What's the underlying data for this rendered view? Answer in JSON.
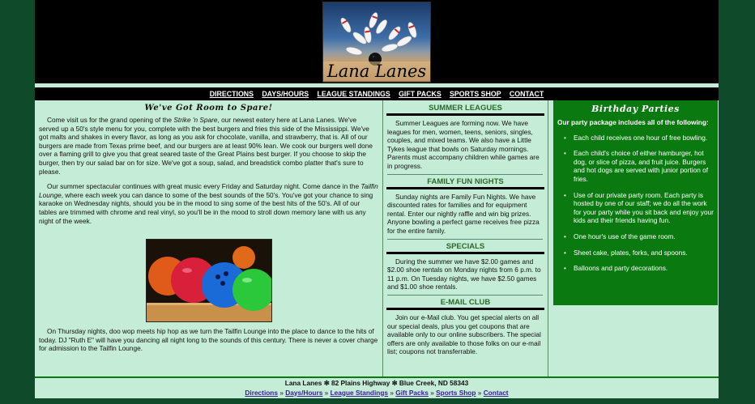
{
  "logo": {
    "text": "Lana Lanes"
  },
  "nav": {
    "items": [
      "DIRECTIONS",
      "DAYS/HOURS",
      "LEAGUE STANDINGS",
      "GIFT PACKS",
      "SPORTS SHOP",
      "CONTACT"
    ]
  },
  "main": {
    "title": "We've Got Room to Spare!",
    "p1_a": "Come visit us for the grand opening of the ",
    "p1_em": "Strike 'n Spare",
    "p1_b": ", our newest eatery here at Lana Lanes. We've served up a 50's style menu for you, complete with the best burgers and fries this side of the Mississippi. We've got malts and shakes in every flavor, as long as you ask for chocolate, vanilla, and strawberry, that is. All of our burgers are made from Texas prime beef, and our burgers are at least 90% lean. We cook our burgers well done over a flaming grill to give you that great seared taste of the Great Plains best burger. If you choose to skip the burger, then try our salad bar on for size. We've got a soup, salad, and breadstick combo platter that's sure to please.",
    "p2_a": "Our summer spectacular continues with great music every Friday and Saturday night. Come dance in the ",
    "p2_em": "Tailfin Lounge",
    "p2_b": ", where each week you can dance to some of the best sounds of the 50's. You've got your chance to sing karaoke on Wednesday nights, should you be in the mood to sing some of the best hits of the 50's. All of our tables are trimmed with chrome and real vinyl, so you'll be in the mood to stroll down memory lane with us any night of the week.",
    "p3": "On Thursday nights, doo wop meets hip hop as we turn the Tailfin Lounge into the place to dance to the hits of today. DJ \"Ruth E\" will have you dancing all night long to the sounds of this century. There is never a cover charge for admission to the Tailfin Lounge."
  },
  "sections": [
    {
      "title": "SUMMER LEAGUES",
      "body": "Summer Leagues are forming now. We have leagues for men, women, teens, seniors, singles, couples, and mixed teams. We also have a Little Tykes league that bowls on Saturday mornings. Parents must accompany children while games are in progress."
    },
    {
      "title": "FAMILY FUN NIGHTS",
      "body": "Sunday nights are Family Fun Nights. We have discounted rates for families and for equipment rental. Enter our nightly raffle and win big prizes. Anyone bowling a perfect game receives free pizza for the entire family."
    },
    {
      "title": "SPECIALS",
      "body": "During the summer we have $2.00 games and $2.00 shoe rentals on Monday nights from 6 p.m. to 11 p.m. On Tuesday nights, we have $2.50 games and $1.00 shoe rentals."
    },
    {
      "title": "E-MAIL CLUB",
      "body": "Join our e-Mail club. You get special alerts on all our special deals, plus you get coupons that are available only to our online subscribers. The special offers are only available to those folks on our e-mail list; coupons not transferrable."
    }
  ],
  "birthday": {
    "title": "Birthday Parties",
    "intro": "Our party package includes all of the following:",
    "items": [
      "Each child receives one hour of free bowling.",
      "Each child's choice of either hamburger, hot dog, or slice of pizza, and fruit juice. Burgers and hot dogs are served with junior portion of fries.",
      "Use of our private party room. Each party is hosted by one of our staff; we do all the work for your party while you sit back and enjoy your kids and their friends having fun.",
      "One hour's use of the game room.",
      "Sheet cake, plates, forks, and spoons.",
      "Balloons and party decorations."
    ]
  },
  "footer": {
    "address": "Lana Lanes ✻ 82 Plains Highway ✻ Blue Creek, ND 58343",
    "links": [
      "Directions",
      "Days/Hours",
      "League Standings",
      "Gift Packs",
      "Sports Shop",
      "Contact"
    ],
    "separator": "»"
  },
  "colors": {
    "page_bg": "#c5ecd6",
    "outer_bg": "#0f4a2a",
    "accent_green": "#0a7a10",
    "section_title": "#2a6a2a"
  }
}
